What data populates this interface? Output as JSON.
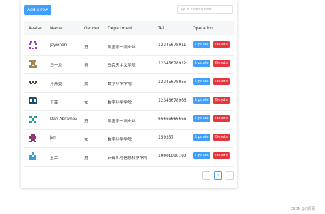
{
  "toolbar": {
    "add_label": "Add a row",
    "search_placeholder": "input search text"
  },
  "table": {
    "headers": [
      "Avatar",
      "Name",
      "Gender",
      "Department",
      "Tel",
      "Operation"
    ],
    "rows": [
      {
        "name": "jaywhen",
        "gender": "男",
        "department": "某国家一流专业",
        "tel": "12345678911",
        "avatar_color": "#a33ad6"
      },
      {
        "name": "马一龙",
        "gender": "男",
        "department": "马克思主义学院",
        "tel": "12345678922",
        "avatar_color": "#a48a52"
      },
      {
        "name": "孙燕姿",
        "gender": "女",
        "department": "数字科学学院",
        "tel": "12345678955",
        "avatar_color": "#3f4b2c"
      },
      {
        "name": "王菲",
        "gender": "女",
        "department": "数字科学学院",
        "tel": "12345678966",
        "avatar_color": "#1c4f6b"
      },
      {
        "name": "Dan Abramov",
        "gender": "男",
        "department": "某国家一流专业",
        "tel": "66666666666",
        "avatar_color": "#2a9a92"
      },
      {
        "name": "jan",
        "gender": "女",
        "department": "数字科学学院",
        "tel": "159357",
        "avatar_color": "#8a3a7a"
      },
      {
        "name": "王二",
        "gender": "男",
        "department": "计算机与信息科学学院",
        "tel": "19991999199",
        "avatar_color": "#3a9fd6"
      }
    ],
    "update_label": "Update",
    "delete_label": "Delete"
  },
  "pagination": {
    "prev": "‹",
    "current": "1",
    "next": "›"
  },
  "watermark": "CSDN @刘哥码"
}
